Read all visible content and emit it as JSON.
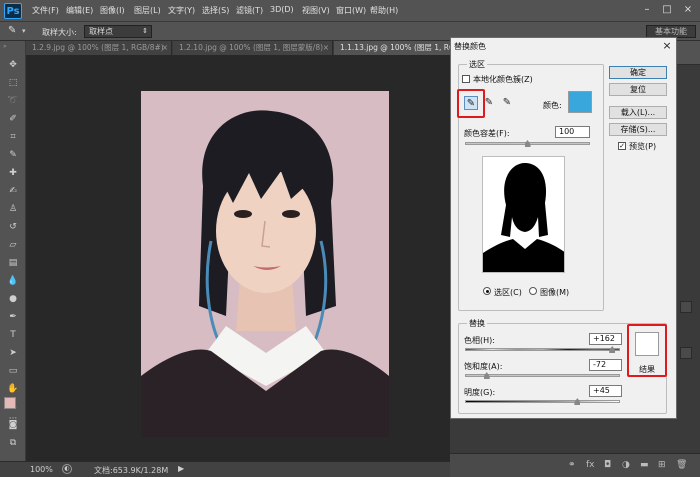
{
  "app": {
    "logo": "Ps"
  },
  "menu": [
    "文件(F)",
    "编辑(E)",
    "图像(I)",
    "图层(L)",
    "文字(Y)",
    "选择(S)",
    "滤镜(T)",
    "3D(D)",
    "视图(V)",
    "窗口(W)",
    "帮助(H)"
  ],
  "options": {
    "sample_size_label": "取样大小:",
    "sample_size_value": "取样点",
    "workspace": "基本功能"
  },
  "tabs": [
    {
      "label": "1.2.9.jpg @ 100% (图层 1, RGB/8#)",
      "close": "×"
    },
    {
      "label": "1.2.10.jpg @ 100% (图层 1, 图层蒙版/8)",
      "close": "×"
    },
    {
      "label": "1.1.13.jpg @ 100% (图层 1, RGB/8)",
      "close": "×"
    }
  ],
  "status": {
    "zoom": "100%",
    "doc": "文档:653.9K/1.28M"
  },
  "dialog": {
    "title": "替换颜色",
    "close": "×",
    "selection_group": "选区",
    "localized_clusters": "本地化颜色簇(Z)",
    "color_label": "颜色:",
    "selection_color": "#3aa7dc",
    "fuzziness_label": "颜色容差(F):",
    "fuzziness_value": "100",
    "radio_selection": "选区(C)",
    "radio_image": "图像(M)",
    "replacement_group": "替换",
    "hue_label": "色相(H):",
    "hue_value": "+162",
    "saturation_label": "饱和度(A):",
    "saturation_value": "-72",
    "lightness_label": "明度(G):",
    "lightness_value": "+45",
    "result_label": "结果",
    "result_color": "#ffffff",
    "buttons": {
      "ok": "确定",
      "reset": "复位",
      "load": "载入(L)...",
      "save": "存储(S)...",
      "preview": "预览(P)"
    },
    "preview_checked": true
  }
}
